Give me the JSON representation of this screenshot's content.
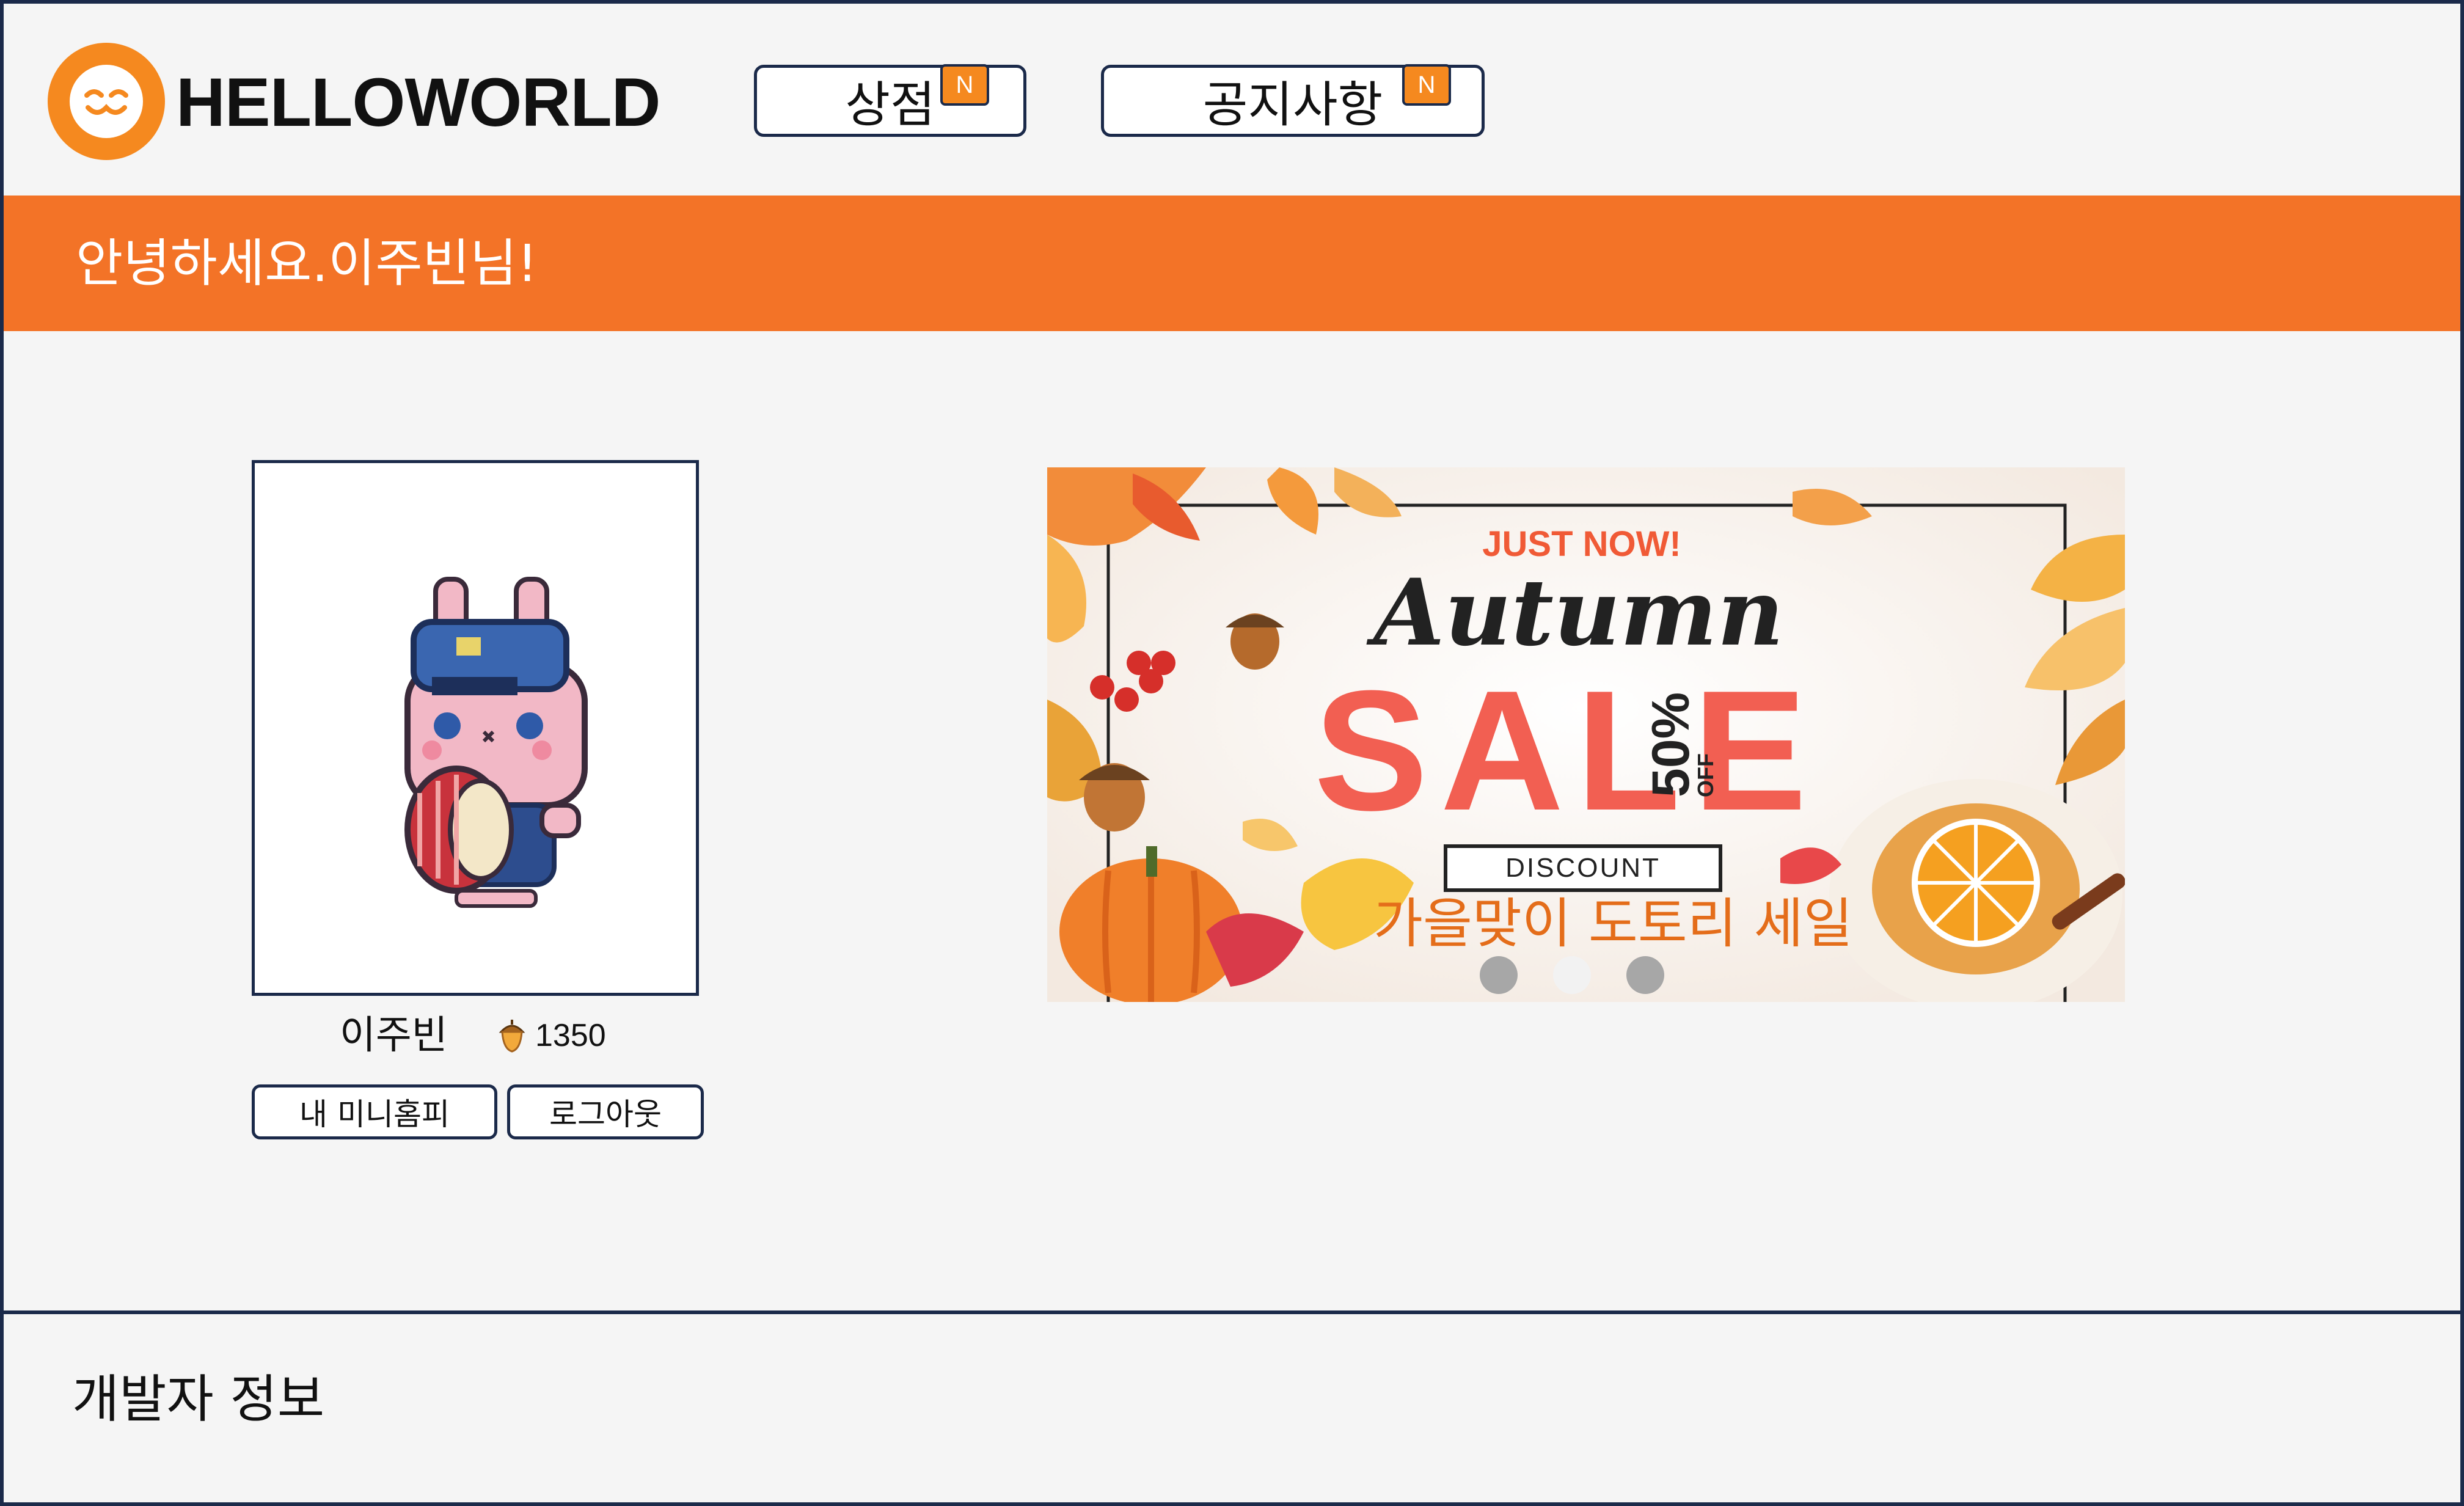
{
  "header": {
    "logo_text": "HELLOWORLD",
    "nav": [
      {
        "label": "상점",
        "badge": "N"
      },
      {
        "label": "공지사항",
        "badge": "N"
      }
    ]
  },
  "greeting": "안녕하세요.이주빈님!",
  "profile": {
    "name": "이주빈",
    "acorns": "1350",
    "buttons": {
      "minihompy": "내 미니홈피",
      "logout": "로그아웃"
    }
  },
  "banner": {
    "headline": "JUST NOW!",
    "script_title": "Autumn",
    "big_text": "SALE",
    "percent": "50%",
    "off": "OFF",
    "discount": "DISCOUNT",
    "overlay_text": "가을맞이 도토리 세일",
    "active_slide": 2,
    "slide_count": 3
  },
  "footer": {
    "developer_info": "개발자 정보"
  },
  "colors": {
    "accent": "#f37327",
    "logo": "#f5891f",
    "border": "#1b2a4a",
    "sale_red": "#f25f52"
  }
}
